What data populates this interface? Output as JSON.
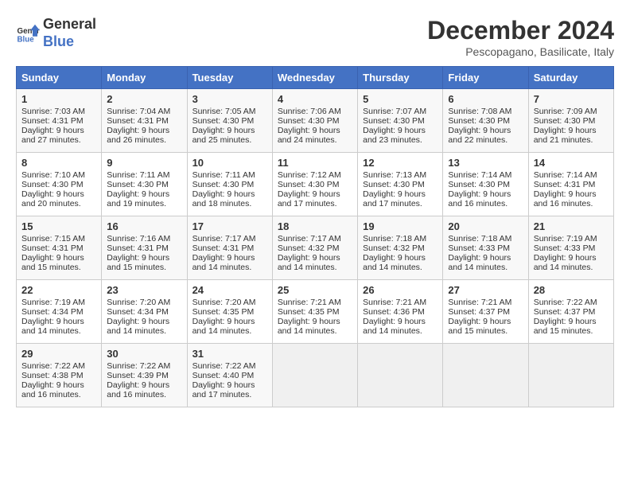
{
  "logo": {
    "line1": "General",
    "line2": "Blue"
  },
  "title": "December 2024",
  "location": "Pescopagano, Basilicate, Italy",
  "weekdays": [
    "Sunday",
    "Monday",
    "Tuesday",
    "Wednesday",
    "Thursday",
    "Friday",
    "Saturday"
  ],
  "weeks": [
    [
      {
        "day": "1",
        "lines": [
          "Sunrise: 7:03 AM",
          "Sunset: 4:31 PM",
          "Daylight: 9 hours",
          "and 27 minutes."
        ]
      },
      {
        "day": "2",
        "lines": [
          "Sunrise: 7:04 AM",
          "Sunset: 4:31 PM",
          "Daylight: 9 hours",
          "and 26 minutes."
        ]
      },
      {
        "day": "3",
        "lines": [
          "Sunrise: 7:05 AM",
          "Sunset: 4:30 PM",
          "Daylight: 9 hours",
          "and 25 minutes."
        ]
      },
      {
        "day": "4",
        "lines": [
          "Sunrise: 7:06 AM",
          "Sunset: 4:30 PM",
          "Daylight: 9 hours",
          "and 24 minutes."
        ]
      },
      {
        "day": "5",
        "lines": [
          "Sunrise: 7:07 AM",
          "Sunset: 4:30 PM",
          "Daylight: 9 hours",
          "and 23 minutes."
        ]
      },
      {
        "day": "6",
        "lines": [
          "Sunrise: 7:08 AM",
          "Sunset: 4:30 PM",
          "Daylight: 9 hours",
          "and 22 minutes."
        ]
      },
      {
        "day": "7",
        "lines": [
          "Sunrise: 7:09 AM",
          "Sunset: 4:30 PM",
          "Daylight: 9 hours",
          "and 21 minutes."
        ]
      }
    ],
    [
      {
        "day": "8",
        "lines": [
          "Sunrise: 7:10 AM",
          "Sunset: 4:30 PM",
          "Daylight: 9 hours",
          "and 20 minutes."
        ]
      },
      {
        "day": "9",
        "lines": [
          "Sunrise: 7:11 AM",
          "Sunset: 4:30 PM",
          "Daylight: 9 hours",
          "and 19 minutes."
        ]
      },
      {
        "day": "10",
        "lines": [
          "Sunrise: 7:11 AM",
          "Sunset: 4:30 PM",
          "Daylight: 9 hours",
          "and 18 minutes."
        ]
      },
      {
        "day": "11",
        "lines": [
          "Sunrise: 7:12 AM",
          "Sunset: 4:30 PM",
          "Daylight: 9 hours",
          "and 17 minutes."
        ]
      },
      {
        "day": "12",
        "lines": [
          "Sunrise: 7:13 AM",
          "Sunset: 4:30 PM",
          "Daylight: 9 hours",
          "and 17 minutes."
        ]
      },
      {
        "day": "13",
        "lines": [
          "Sunrise: 7:14 AM",
          "Sunset: 4:30 PM",
          "Daylight: 9 hours",
          "and 16 minutes."
        ]
      },
      {
        "day": "14",
        "lines": [
          "Sunrise: 7:14 AM",
          "Sunset: 4:31 PM",
          "Daylight: 9 hours",
          "and 16 minutes."
        ]
      }
    ],
    [
      {
        "day": "15",
        "lines": [
          "Sunrise: 7:15 AM",
          "Sunset: 4:31 PM",
          "Daylight: 9 hours",
          "and 15 minutes."
        ]
      },
      {
        "day": "16",
        "lines": [
          "Sunrise: 7:16 AM",
          "Sunset: 4:31 PM",
          "Daylight: 9 hours",
          "and 15 minutes."
        ]
      },
      {
        "day": "17",
        "lines": [
          "Sunrise: 7:17 AM",
          "Sunset: 4:31 PM",
          "Daylight: 9 hours",
          "and 14 minutes."
        ]
      },
      {
        "day": "18",
        "lines": [
          "Sunrise: 7:17 AM",
          "Sunset: 4:32 PM",
          "Daylight: 9 hours",
          "and 14 minutes."
        ]
      },
      {
        "day": "19",
        "lines": [
          "Sunrise: 7:18 AM",
          "Sunset: 4:32 PM",
          "Daylight: 9 hours",
          "and 14 minutes."
        ]
      },
      {
        "day": "20",
        "lines": [
          "Sunrise: 7:18 AM",
          "Sunset: 4:33 PM",
          "Daylight: 9 hours",
          "and 14 minutes."
        ]
      },
      {
        "day": "21",
        "lines": [
          "Sunrise: 7:19 AM",
          "Sunset: 4:33 PM",
          "Daylight: 9 hours",
          "and 14 minutes."
        ]
      }
    ],
    [
      {
        "day": "22",
        "lines": [
          "Sunrise: 7:19 AM",
          "Sunset: 4:34 PM",
          "Daylight: 9 hours",
          "and 14 minutes."
        ]
      },
      {
        "day": "23",
        "lines": [
          "Sunrise: 7:20 AM",
          "Sunset: 4:34 PM",
          "Daylight: 9 hours",
          "and 14 minutes."
        ]
      },
      {
        "day": "24",
        "lines": [
          "Sunrise: 7:20 AM",
          "Sunset: 4:35 PM",
          "Daylight: 9 hours",
          "and 14 minutes."
        ]
      },
      {
        "day": "25",
        "lines": [
          "Sunrise: 7:21 AM",
          "Sunset: 4:35 PM",
          "Daylight: 9 hours",
          "and 14 minutes."
        ]
      },
      {
        "day": "26",
        "lines": [
          "Sunrise: 7:21 AM",
          "Sunset: 4:36 PM",
          "Daylight: 9 hours",
          "and 14 minutes."
        ]
      },
      {
        "day": "27",
        "lines": [
          "Sunrise: 7:21 AM",
          "Sunset: 4:37 PM",
          "Daylight: 9 hours",
          "and 15 minutes."
        ]
      },
      {
        "day": "28",
        "lines": [
          "Sunrise: 7:22 AM",
          "Sunset: 4:37 PM",
          "Daylight: 9 hours",
          "and 15 minutes."
        ]
      }
    ],
    [
      {
        "day": "29",
        "lines": [
          "Sunrise: 7:22 AM",
          "Sunset: 4:38 PM",
          "Daylight: 9 hours",
          "and 16 minutes."
        ]
      },
      {
        "day": "30",
        "lines": [
          "Sunrise: 7:22 AM",
          "Sunset: 4:39 PM",
          "Daylight: 9 hours",
          "and 16 minutes."
        ]
      },
      {
        "day": "31",
        "lines": [
          "Sunrise: 7:22 AM",
          "Sunset: 4:40 PM",
          "Daylight: 9 hours",
          "and 17 minutes."
        ]
      },
      null,
      null,
      null,
      null
    ]
  ]
}
